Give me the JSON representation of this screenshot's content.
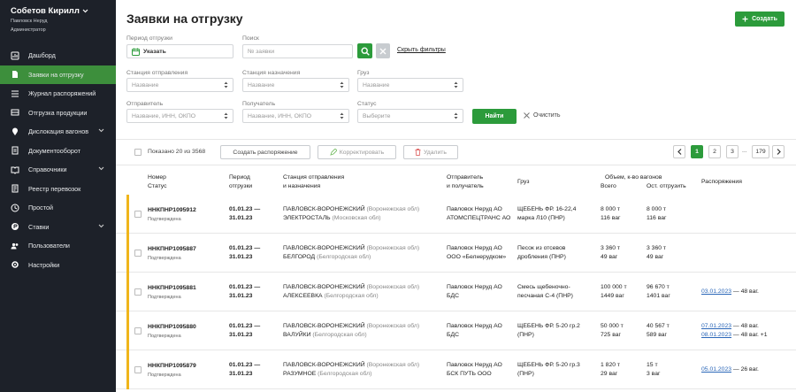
{
  "user": {
    "name": "Собетов Кирилл",
    "org": "Павловск Неруд",
    "role": "Администратор"
  },
  "nav": [
    {
      "label": "Дашборд",
      "icon": "dashboard-icon",
      "active": false,
      "chev": false
    },
    {
      "label": "Заявки на отгрузку",
      "icon": "document-icon",
      "active": true,
      "chev": false
    },
    {
      "label": "Журнал распоряжений",
      "icon": "list-icon",
      "active": false,
      "chev": false
    },
    {
      "label": "Отгрузка продукции",
      "icon": "shipment-icon",
      "active": false,
      "chev": false
    },
    {
      "label": "Дислокация вагонов",
      "icon": "location-icon",
      "active": false,
      "chev": true
    },
    {
      "label": "Документооборот",
      "icon": "docs-icon",
      "active": false,
      "chev": false
    },
    {
      "label": "Справочники",
      "icon": "book-icon",
      "active": false,
      "chev": true
    },
    {
      "label": "Реестр перевозок",
      "icon": "registry-icon",
      "active": false,
      "chev": false
    },
    {
      "label": "Простой",
      "icon": "clock-icon",
      "active": false,
      "chev": false
    },
    {
      "label": "Ставки",
      "icon": "rate-icon",
      "active": false,
      "chev": true
    },
    {
      "label": "Пользователи",
      "icon": "users-icon",
      "active": false,
      "chev": false
    },
    {
      "label": "Настройки",
      "icon": "gear-icon",
      "active": false,
      "chev": false
    }
  ],
  "page": {
    "title": "Заявки на отгрузку",
    "create": "Создать"
  },
  "filters": {
    "period_label": "Период отгрузки",
    "period_value": "Указать",
    "search_label": "Поиск",
    "search_placeholder": "№ заявки",
    "hide": "Скрыть фильтры",
    "dep_label": "Станция отправления",
    "dep_ph": "Название",
    "dest_label": "Станция назначения",
    "dest_ph": "Название",
    "cargo_label": "Груз",
    "cargo_ph": "Название",
    "sender_label": "Отправитель",
    "sender_ph": "Название, ИНН, ОКПО",
    "receiver_label": "Получатель",
    "receiver_ph": "Название, ИНН, ОКПО",
    "status_label": "Статус",
    "status_ph": "Выберите",
    "find": "Найти",
    "clear": "Очистить"
  },
  "toolbar": {
    "shown": "Показано 20 из 3568",
    "create_order": "Создать распоряжение",
    "edit": "Корректировать",
    "delete": "Удалить"
  },
  "pagination": {
    "pages": [
      "1",
      "2",
      "3",
      "...",
      "179"
    ],
    "current": "1"
  },
  "headers": {
    "num": "Номер",
    "status": "Статус",
    "period": "Период",
    "period2": "отгрузки",
    "station": "Станция отправления",
    "station2": "и назначения",
    "sender": "Отправитель",
    "sender2": "и получатель",
    "cargo": "Груз",
    "volume": "Объем, к-во вагонов",
    "total": "Всего",
    "remain": "Ост. отгрузить",
    "orders": "Распоряжения"
  },
  "rows": [
    {
      "num": "ННКПНР1095912",
      "status": "Подтверждена",
      "p1": "01.01.23 —",
      "p2": "31.01.23",
      "s1": "ПАВЛОВСК-ВОРОНЕЖСКИЙ",
      "s1r": "(Воронежская обл)",
      "s2": "ЭЛЕКТРОСТАЛЬ",
      "s2r": "(Московская обл)",
      "o1": "Павловск Неруд АО",
      "o2": "АТОМСПЕЦТРАНС АО",
      "c1": "ЩЕБЕНЬ ФР. 16-22,4",
      "c2": "марка Л10 (ПНР)",
      "t1": "8 000 т",
      "t2": "116 ваг",
      "r1": "8 000 т",
      "r2": "116 ваг",
      "orders": []
    },
    {
      "num": "ННКПНР1095887",
      "status": "Подтверждена",
      "p1": "01.01.23 —",
      "p2": "31.01.23",
      "s1": "ПАВЛОВСК-ВОРОНЕЖСКИЙ",
      "s1r": "(Воронежская обл)",
      "s2": "БЕЛГОРОД",
      "s2r": "(Белгородская обл)",
      "o1": "Павловск Неруд АО",
      "o2": "ООО «Белнерудком»",
      "c1": "Песок из отсевов",
      "c2": "дробления (ПНР)",
      "t1": "3 360 т",
      "t2": "49 ваг",
      "r1": "3 360 т",
      "r2": "49 ваг",
      "orders": []
    },
    {
      "num": "ННКПНР1095881",
      "status": "Подтверждена",
      "p1": "01.01.23 —",
      "p2": "31.01.23",
      "s1": "ПАВЛОВСК-ВОРОНЕЖСКИЙ",
      "s1r": "(Воронежская обл)",
      "s2": "АЛЕКСЕЕВКА",
      "s2r": "(Белгородская обл)",
      "o1": "Павловск Неруд АО",
      "o2": "БДС",
      "c1": "Смесь щебеночно-",
      "c2": "песчаная С-4 (ПНР)",
      "t1": "100 000 т",
      "t2": "1449 ваг",
      "r1": "96 670 т",
      "r2": "1401 ваг",
      "orders": [
        {
          "date": "03.01.2023",
          "rest": " — 48 ваг."
        }
      ]
    },
    {
      "num": "ННКПНР1095880",
      "status": "Подтверждена",
      "p1": "01.01.23 —",
      "p2": "31.01.23",
      "s1": "ПАВЛОВСК-ВОРОНЕЖСКИЙ",
      "s1r": "(Воронежская обл)",
      "s2": "ВАЛУЙКИ",
      "s2r": "(Белгородская обл)",
      "o1": "Павловск Неруд АО",
      "o2": "БДС",
      "c1": "ЩЕБЕНЬ ФР. 5-20 гр.2",
      "c2": "(ПНР)",
      "t1": "50 000 т",
      "t2": "725 ваг",
      "r1": "40 567 т",
      "r2": "589 ваг",
      "orders": [
        {
          "date": "07.01.2023",
          "rest": " — 48 ваг."
        },
        {
          "date": "08.01.2023",
          "rest": " — 48 ваг. +1"
        }
      ]
    },
    {
      "num": "ННКПНР1095879",
      "status": "Подтверждена",
      "p1": "01.01.23 —",
      "p2": "31.01.23",
      "s1": "ПАВЛОВСК-ВОРОНЕЖСКИЙ",
      "s1r": "(Воронежская обл)",
      "s2": "РАЗУМНОЕ",
      "s2r": "(Белгородская обл)",
      "o1": "Павловск Неруд АО",
      "o2": "БСК ПУТЬ ООО",
      "c1": "ЩЕБЕНЬ ФР. 5-20 гр.3",
      "c2": "(ПНР)",
      "t1": "1 820 т",
      "t2": "29 ваг",
      "r1": "15 т",
      "r2": "3 ваг",
      "orders": [
        {
          "date": "05.01.2023",
          "rest": " — 26 ваг."
        }
      ]
    }
  ],
  "colors": {
    "sidebar": "#1d2129",
    "accent": "#2c9b3b",
    "active_nav": "#3d8f3c",
    "row_marker": "#f0b51a",
    "link": "#2a66b8"
  }
}
